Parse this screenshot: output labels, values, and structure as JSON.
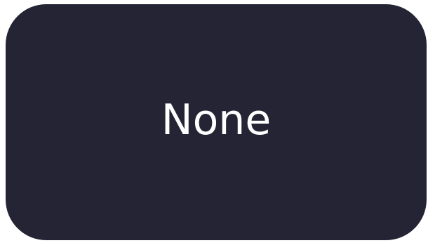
{
  "option": {
    "label": "None",
    "background_color": "#252435",
    "text_color": "#ffffff"
  }
}
